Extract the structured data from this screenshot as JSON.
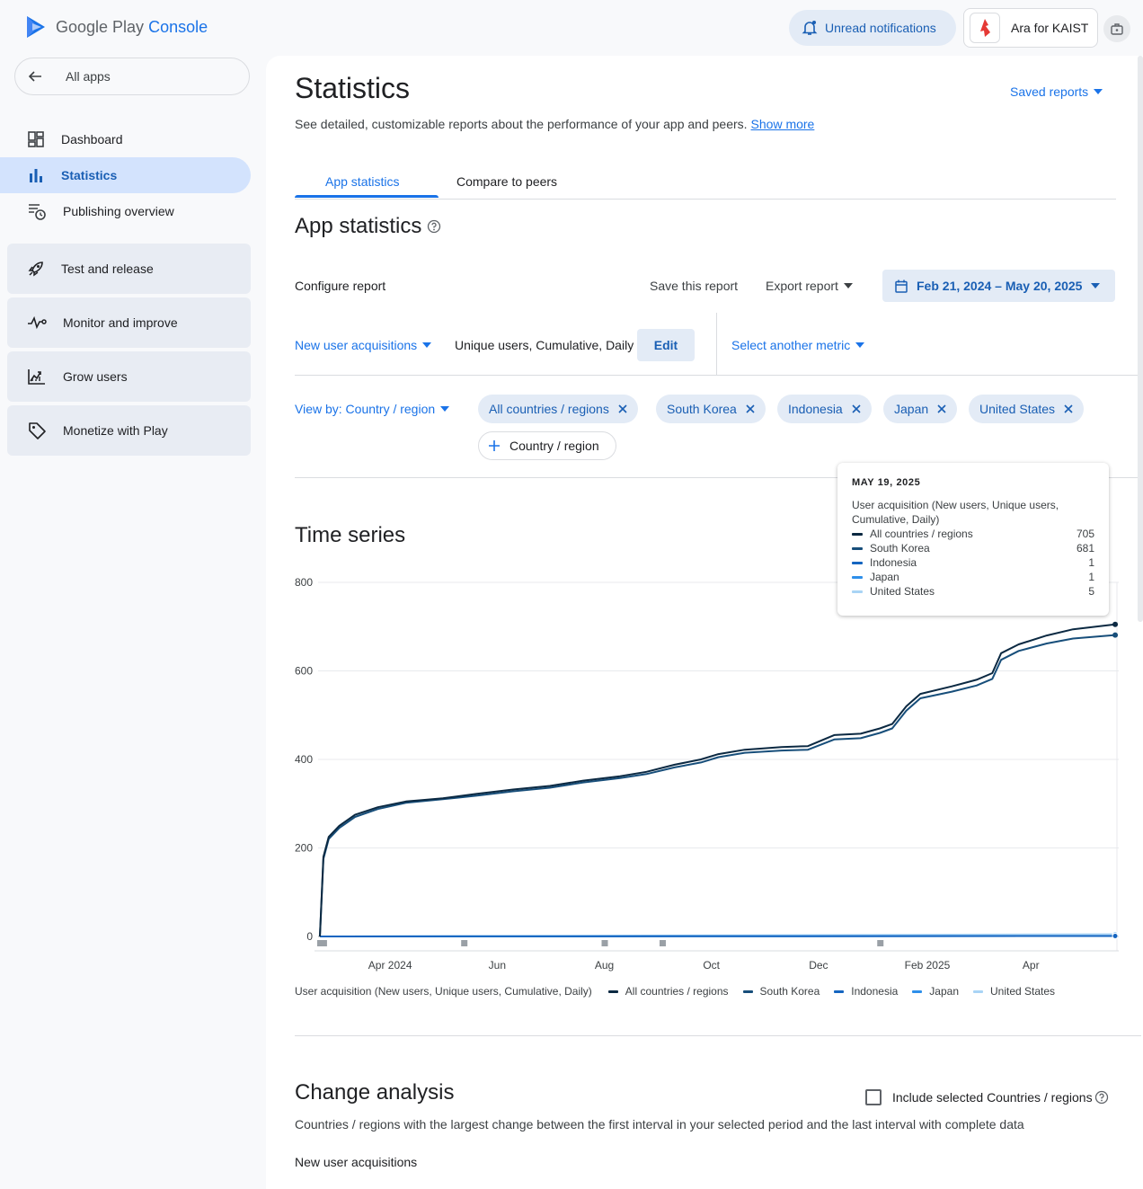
{
  "header": {
    "logo_text": "Google Play",
    "logo_console": "Console",
    "notifications_label": "Unread notifications",
    "account_name": "Ara for KAIST"
  },
  "sidebar": {
    "all_apps": "All apps",
    "items": [
      {
        "label": "Dashboard",
        "icon": "dashboard-icon"
      },
      {
        "label": "Statistics",
        "icon": "bar-chart-icon",
        "active": true
      },
      {
        "label": "Publishing overview",
        "icon": "publishing-icon"
      }
    ],
    "groups": [
      {
        "label": "Test and release",
        "icon": "rocket-icon"
      },
      {
        "label": "Monitor and improve",
        "icon": "vitals-icon"
      },
      {
        "label": "Grow users",
        "icon": "grow-icon"
      },
      {
        "label": "Monetize with Play",
        "icon": "tag-icon"
      }
    ]
  },
  "page": {
    "title": "Statistics",
    "saved_reports": "Saved reports",
    "description": "See detailed, customizable reports about the performance of your app and peers.",
    "show_more": "Show more",
    "tabs": [
      "App statistics",
      "Compare to peers"
    ],
    "section_title": "App statistics",
    "configure_report": "Configure report",
    "save_report": "Save this report",
    "export_report": "Export report",
    "date_range": "Feb 21, 2024 – May 20, 2025",
    "metric": "New user acquisitions",
    "metric_desc": "Unique users, Cumulative, Daily",
    "edit": "Edit",
    "select_metric": "Select another metric",
    "view_by": "View by: Country / region",
    "chips": [
      "All countries / regions",
      "South Korea",
      "Indonesia",
      "Japan",
      "United States"
    ],
    "add_chip": "Country / region",
    "time_series_title": "Time series"
  },
  "tooltip": {
    "date": "MAY 19, 2025",
    "metric": "User acquisition (New users, Unique users, Cumulative, Daily)",
    "rows": [
      {
        "label": "All countries / regions",
        "value": "705"
      },
      {
        "label": "South Korea",
        "value": "681"
      },
      {
        "label": "Indonesia",
        "value": "1"
      },
      {
        "label": "Japan",
        "value": "1"
      },
      {
        "label": "United States",
        "value": "5"
      }
    ]
  },
  "legend": {
    "title": "User acquisition (New users, Unique users, Cumulative, Daily)"
  },
  "change_analysis": {
    "title": "Change analysis",
    "checkbox_label": "Include selected Countries / regions",
    "description": "Countries / regions with the largest change between the first interval in your selected period and the last interval with complete data",
    "subtitle": "New user acquisitions"
  },
  "colors": {
    "accent": "#1a73e8",
    "all_countries": "#0b2942",
    "south_korea": "#174e7a",
    "indonesia": "#1565c0",
    "japan": "#2e8fea",
    "united_states": "#a9d4f5"
  },
  "chart_data": {
    "type": "line",
    "ylim": [
      0,
      800
    ],
    "yticks": [
      0,
      200,
      400,
      600,
      800
    ],
    "xticks": [
      "Apr 2024",
      "Jun",
      "Aug",
      "Oct",
      "Dec",
      "Feb 2025",
      "Apr"
    ],
    "x_range": [
      "2024-02-21",
      "2025-05-20"
    ],
    "series": [
      {
        "name": "All countries / regions",
        "points": [
          [
            "2024-02-21",
            0
          ],
          [
            "2024-02-23",
            180
          ],
          [
            "2024-02-26",
            225
          ],
          [
            "2024-03-03",
            250
          ],
          [
            "2024-03-12",
            275
          ],
          [
            "2024-03-25",
            292
          ],
          [
            "2024-04-10",
            305
          ],
          [
            "2024-05-01",
            312
          ],
          [
            "2024-05-20",
            322
          ],
          [
            "2024-06-10",
            332
          ],
          [
            "2024-07-01",
            340
          ],
          [
            "2024-07-20",
            352
          ],
          [
            "2024-08-10",
            362
          ],
          [
            "2024-08-25",
            372
          ],
          [
            "2024-09-10",
            388
          ],
          [
            "2024-09-25",
            400
          ],
          [
            "2024-10-05",
            412
          ],
          [
            "2024-10-20",
            422
          ],
          [
            "2024-11-10",
            428
          ],
          [
            "2024-11-25",
            430
          ],
          [
            "2024-12-10",
            455
          ],
          [
            "2024-12-25",
            458
          ],
          [
            "2025-01-05",
            470
          ],
          [
            "2025-01-12",
            480
          ],
          [
            "2025-01-20",
            520
          ],
          [
            "2025-01-28",
            548
          ],
          [
            "2025-02-15",
            565
          ],
          [
            "2025-03-01",
            580
          ],
          [
            "2025-03-10",
            595
          ],
          [
            "2025-03-15",
            640
          ],
          [
            "2025-03-25",
            660
          ],
          [
            "2025-04-10",
            680
          ],
          [
            "2025-04-25",
            694
          ],
          [
            "2025-05-19",
            705
          ]
        ]
      },
      {
        "name": "South Korea",
        "points": [
          [
            "2024-02-21",
            0
          ],
          [
            "2024-02-23",
            175
          ],
          [
            "2024-02-26",
            220
          ],
          [
            "2024-03-03",
            245
          ],
          [
            "2024-03-12",
            270
          ],
          [
            "2024-03-25",
            288
          ],
          [
            "2024-04-10",
            302
          ],
          [
            "2024-05-01",
            310
          ],
          [
            "2024-05-20",
            318
          ],
          [
            "2024-06-10",
            328
          ],
          [
            "2024-07-01",
            336
          ],
          [
            "2024-07-20",
            348
          ],
          [
            "2024-08-10",
            358
          ],
          [
            "2024-08-25",
            367
          ],
          [
            "2024-09-10",
            382
          ],
          [
            "2024-09-25",
            393
          ],
          [
            "2024-10-05",
            405
          ],
          [
            "2024-10-20",
            415
          ],
          [
            "2024-11-10",
            420
          ],
          [
            "2024-11-25",
            422
          ],
          [
            "2024-12-10",
            445
          ],
          [
            "2024-12-25",
            448
          ],
          [
            "2025-01-05",
            460
          ],
          [
            "2025-01-12",
            470
          ],
          [
            "2025-01-20",
            510
          ],
          [
            "2025-01-28",
            538
          ],
          [
            "2025-02-15",
            553
          ],
          [
            "2025-03-01",
            567
          ],
          [
            "2025-03-10",
            582
          ],
          [
            "2025-03-15",
            625
          ],
          [
            "2025-03-25",
            645
          ],
          [
            "2025-04-10",
            662
          ],
          [
            "2025-04-25",
            673
          ],
          [
            "2025-05-19",
            681
          ]
        ]
      },
      {
        "name": "Indonesia",
        "points": [
          [
            "2024-02-21",
            0
          ],
          [
            "2025-05-19",
            1
          ]
        ]
      },
      {
        "name": "Japan",
        "points": [
          [
            "2024-02-21",
            0
          ],
          [
            "2025-05-19",
            1
          ]
        ]
      },
      {
        "name": "United States",
        "points": [
          [
            "2024-02-21",
            0
          ],
          [
            "2025-05-19",
            5
          ]
        ]
      }
    ],
    "annotation_markers": [
      "2024-02-21",
      "2024-02-22",
      "2024-02-23",
      "2024-05-13",
      "2024-08-01",
      "2024-09-03",
      "2025-01-05"
    ]
  }
}
